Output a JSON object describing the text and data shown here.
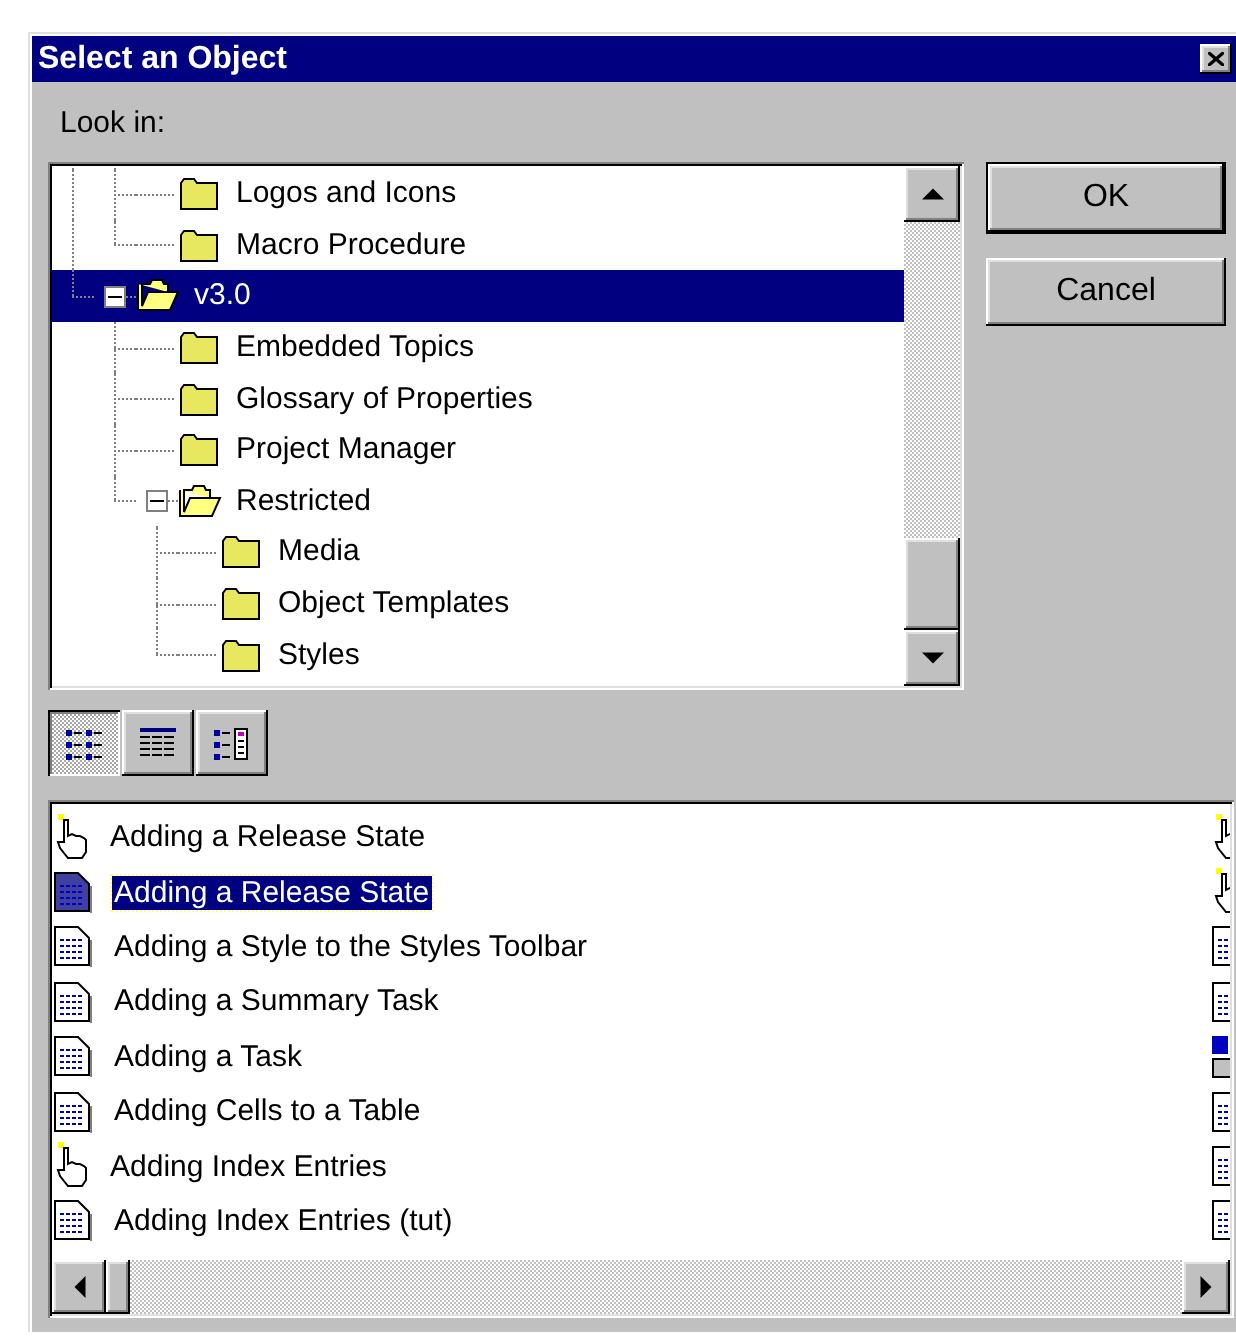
{
  "window": {
    "title": "Select an Object"
  },
  "look_in": {
    "label": "Look in:"
  },
  "tree": {
    "items": [
      {
        "children": [
          {
            "label": "Logos and Icons",
            "selected": false
          },
          {
            "label": "Macro Procedure",
            "selected": false
          }
        ]
      },
      {
        "label": "v3.0",
        "selected": true,
        "expanded": true,
        "children": [
          {
            "label": "Embedded Topics",
            "selected": false
          },
          {
            "label": "Glossary of Properties",
            "selected": false
          },
          {
            "label": "Project Manager",
            "selected": false
          },
          {
            "label": "Restricted",
            "selected": false,
            "expanded": true,
            "children": [
              {
                "label": "Media",
                "selected": false
              },
              {
                "label": "Object Templates",
                "selected": false
              },
              {
                "label": "Styles",
                "selected": false
              }
            ]
          }
        ]
      }
    ]
  },
  "buttons": [
    "OK",
    "Cancel"
  ],
  "view_buttons": [
    {
      "kind": "list",
      "selected": true
    },
    {
      "kind": "details",
      "selected": false
    },
    {
      "kind": "custom",
      "selected": false
    }
  ],
  "list": {
    "items": [
      {
        "label": "Adding a Release State",
        "kind": "hand",
        "selected": false
      },
      {
        "label": "Adding a Release State",
        "kind": "doc",
        "selected": true
      },
      {
        "label": "Adding a Style to the Styles Toolbar",
        "kind": "doc",
        "selected": false
      },
      {
        "label": "Adding a Summary Task",
        "kind": "doc",
        "selected": false
      },
      {
        "label": "Adding a Task",
        "kind": "doc",
        "selected": false
      },
      {
        "label": "Adding Cells to a Table",
        "kind": "doc",
        "selected": false
      },
      {
        "label": "Adding Index Entries",
        "kind": "hand",
        "selected": false
      },
      {
        "label": "Adding Index Entries (tut)",
        "kind": "doc",
        "selected": false
      }
    ],
    "column_2": [
      {
        "kind": "hand"
      },
      {
        "kind": "hand"
      },
      {
        "kind": "doc"
      },
      {
        "kind": "doc"
      },
      {
        "kind": "mixed"
      },
      {
        "kind": "doc"
      },
      {
        "kind": "doc"
      },
      {
        "kind": "doc"
      }
    ]
  }
}
